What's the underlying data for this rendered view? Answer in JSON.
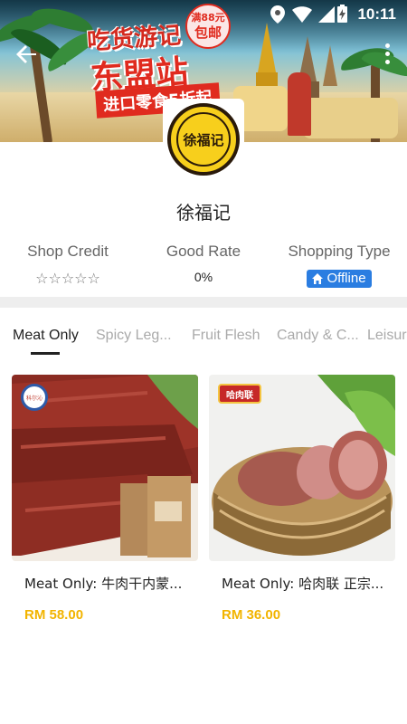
{
  "status_bar": {
    "time": "10:11"
  },
  "banner": {
    "headline_line1": "吃货游记",
    "headline_line2": "东盟站",
    "subline": "进口零食5折起",
    "badge_line1": "满88元",
    "badge_line2": "包邮"
  },
  "shop": {
    "logo_text": "徐福记",
    "name": "徐福记"
  },
  "stats": {
    "credit_label": "Shop Credit",
    "credit_stars": "☆☆☆☆☆",
    "rate_label": "Good Rate",
    "rate_value": "0%",
    "type_label": "Shopping Type",
    "type_value": "Offline"
  },
  "tabs": [
    {
      "label": "Meat Only"
    },
    {
      "label": "Spicy Leg..."
    },
    {
      "label": "Fruit Flesh"
    },
    {
      "label": "Candy & C..."
    },
    {
      "label": "Leisur"
    }
  ],
  "products": [
    {
      "title": "Meat Only: 牛肉干内蒙...",
      "price": "RM 58.00",
      "brand_label": "科尔沁"
    },
    {
      "title": "Meat Only: 哈肉联 正宗...",
      "price": "RM 36.00",
      "brand_label": "哈肉联"
    }
  ],
  "colors": {
    "accent_blue": "#2a7de1",
    "price_yellow": "#f2b400",
    "divider_gray": "#eeeeee"
  }
}
